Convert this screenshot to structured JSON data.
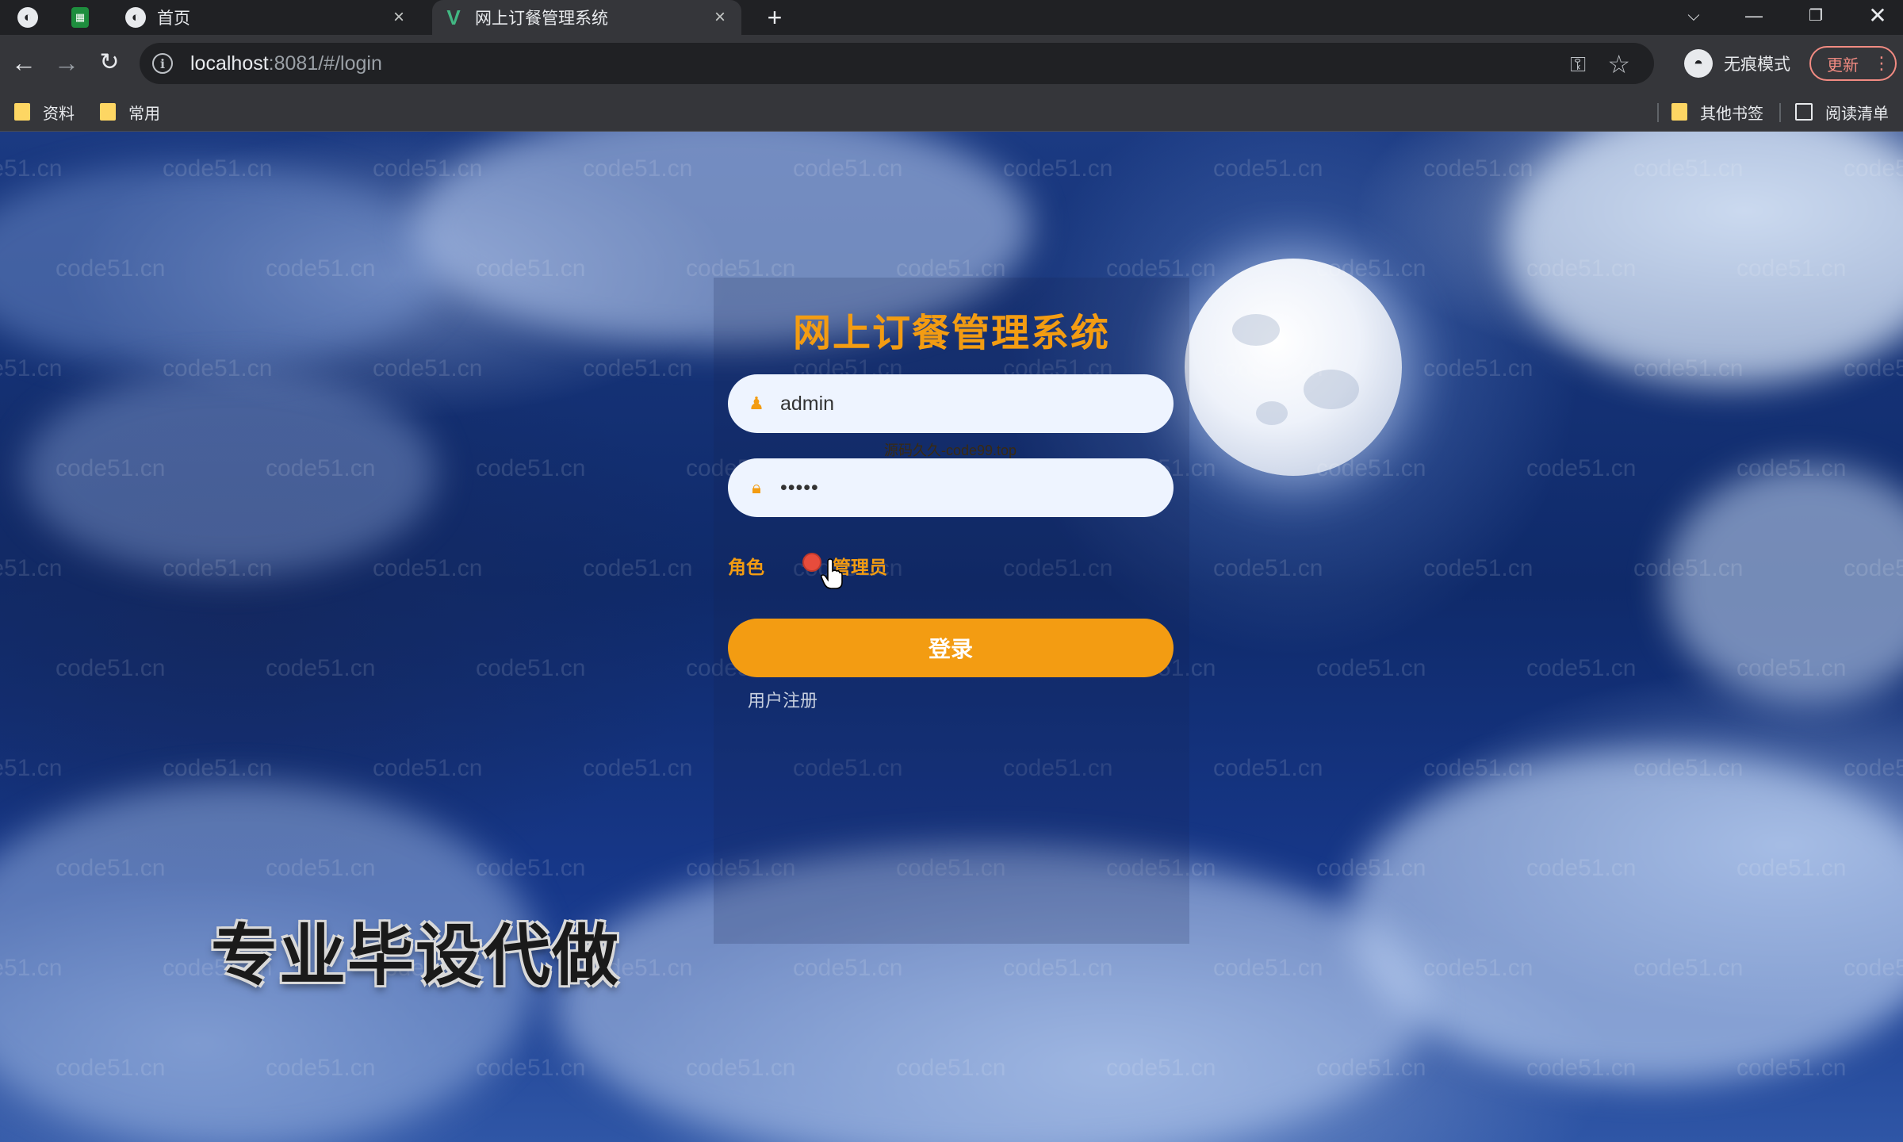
{
  "browser": {
    "tabs": [
      {
        "title": "首页"
      },
      {
        "title": "网上订餐管理系统",
        "active": true
      }
    ],
    "url_host": "localhost",
    "url_rest": ":8081/#/login",
    "profile_label": "无痕模式",
    "update_label": "更新",
    "bookmarks": [
      {
        "label": "资料"
      },
      {
        "label": "常用"
      }
    ],
    "bookmarks_right": [
      {
        "label": "其他书签"
      },
      {
        "label": "阅读清单"
      }
    ]
  },
  "login": {
    "title": "网上订餐管理系统",
    "username_value": "admin",
    "password_value": "•••••",
    "role_label": "角色",
    "role_option": "管理员",
    "role_selected": true,
    "submit_label": "登录",
    "register_label": "用户注册"
  },
  "overlays": {
    "watermark": "code51.cn",
    "source_text": "源码久久-code99.top",
    "promo_text": "专业毕设代做"
  },
  "colors": {
    "accent": "#f39c12",
    "radio": "#e74c3c",
    "sky": "#0f2a6a"
  }
}
